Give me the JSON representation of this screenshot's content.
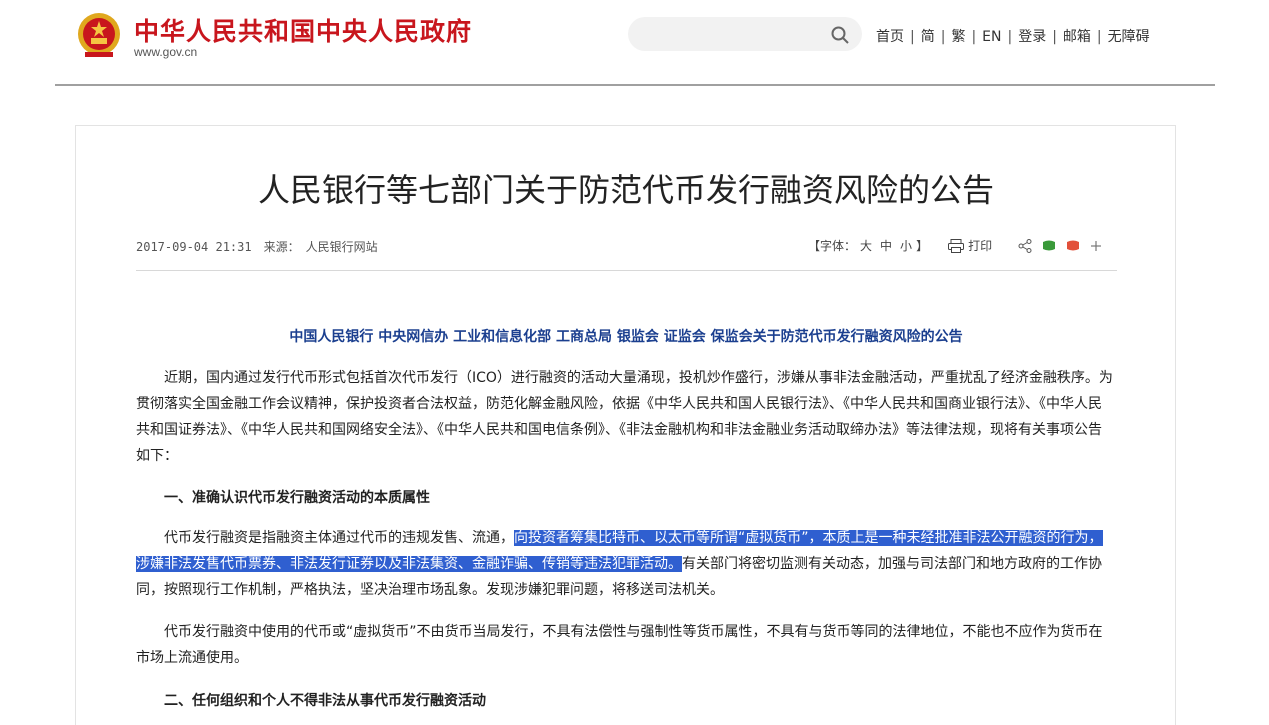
{
  "site": {
    "title": "中华人民共和国中央人民政府",
    "url": "www.gov.cn"
  },
  "search": {
    "placeholder": ""
  },
  "top_nav": [
    "首页",
    "简",
    "繁",
    "EN",
    "登录",
    "邮箱",
    "无障碍"
  ],
  "article": {
    "title": "人民银行等七部门关于防范代币发行融资风险的公告",
    "date": "2017-09-04 21:31",
    "source_label": "来源：",
    "source": "人民银行网站",
    "font_label_open": "【字体：",
    "font_large": "大",
    "font_medium": "中",
    "font_small": "小",
    "font_label_close": "】",
    "print_label": "打印",
    "subtitle": "中国人民银行  中央网信办  工业和信息化部  工商总局  银监会  证监会  保监会关于防范代币发行融资风险的公告",
    "p1": "近期，国内通过发行代币形式包括首次代币发行（ICO）进行融资的活动大量涌现，投机炒作盛行，涉嫌从事非法金融活动，严重扰乱了经济金融秩序。为贯彻落实全国金融工作会议精神，保护投资者合法权益，防范化解金融风险，依据《中华人民共和国人民银行法》、《中华人民共和国商业银行法》、《中华人民共和国证券法》、《中华人民共和国网络安全法》、《中华人民共和国电信条例》、《非法金融机构和非法金融业务活动取缔办法》等法律法规，现将有关事项公告如下：",
    "h1": "一、准确认识代币发行融资活动的本质属性",
    "p2_before": "代币发行融资是指融资主体通过代币的违规发售、流通，",
    "p2_highlight": "向投资者筹集比特币、以太币等所谓“虚拟货币”，本质上是一种未经批准非法公开融资的行为，涉嫌非法发售代币票券、非法发行证券以及非法集资、金融诈骗、传销等违法犯罪活动。",
    "p2_after": "有关部门将密切监测有关动态，加强与司法部门和地方政府的工作协同，按照现行工作机制，严格执法，坚决治理市场乱象。发现涉嫌犯罪问题，将移送司法机关。",
    "p3": "代币发行融资中使用的代币或“虚拟货币”不由货币当局发行，不具有法偿性与强制性等货币属性，不具有与货币等同的法律地位，不能也不应作为货币在市场上流通使用。",
    "h2": "二、任何组织和个人不得非法从事代币发行融资活动"
  },
  "colors": {
    "brand_red": "#c8161d",
    "subtitle_blue": "#1b3f8f",
    "selection": "#2f5fd0"
  }
}
